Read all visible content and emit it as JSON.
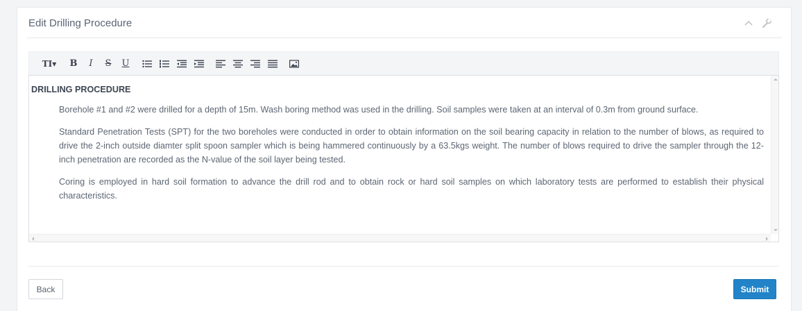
{
  "panel": {
    "title": "Edit Drilling Procedure",
    "tools": [
      {
        "icon": "chevron-up-icon"
      },
      {
        "icon": "wrench-icon"
      }
    ]
  },
  "toolbar": {
    "buttons": [
      {
        "icon": "font-size-icon",
        "label": "TI▾"
      },
      {
        "icon": "bold-icon",
        "label": "B"
      },
      {
        "icon": "italic-icon",
        "label": "I"
      },
      {
        "icon": "strikethrough-icon",
        "label": "S"
      },
      {
        "icon": "underline-icon",
        "label": "U"
      },
      {
        "icon": "bulleted-list-icon"
      },
      {
        "icon": "numbered-list-icon"
      },
      {
        "icon": "outdent-icon"
      },
      {
        "icon": "indent-icon"
      },
      {
        "icon": "align-left-icon"
      },
      {
        "icon": "align-center-icon"
      },
      {
        "icon": "align-right-icon"
      },
      {
        "icon": "justify-icon"
      },
      {
        "icon": "insert-image-icon"
      }
    ]
  },
  "editor": {
    "heading": "DRILLING PROCEDURE",
    "paragraphs": [
      "Borehole #1 and #2 were drilled for a depth of 15m. Wash boring method was used in the drilling. Soil samples were taken at an interval of 0.3m from ground surface.",
      "Standard Penetration Tests (SPT) for the two boreholes were conducted in order to obtain information on the soil bearing capacity in relation to the number of blows, as required to drive the 2-inch outside diamter split spoon sampler which is being hammered continuously by a 63.5kgs weight. The number of blows required to drive the sampler through the 12-inch penetration are recorded as the N-value of the soil layer being tested.",
      "Coring is employed in hard soil formation to advance the drill rod and to obtain rock or hard soil samples on which laboratory tests are performed to establish their physical characteristics."
    ]
  },
  "actions": {
    "back_label": "Back",
    "submit_label": "Submit",
    "submit_color": "#2283c8"
  }
}
